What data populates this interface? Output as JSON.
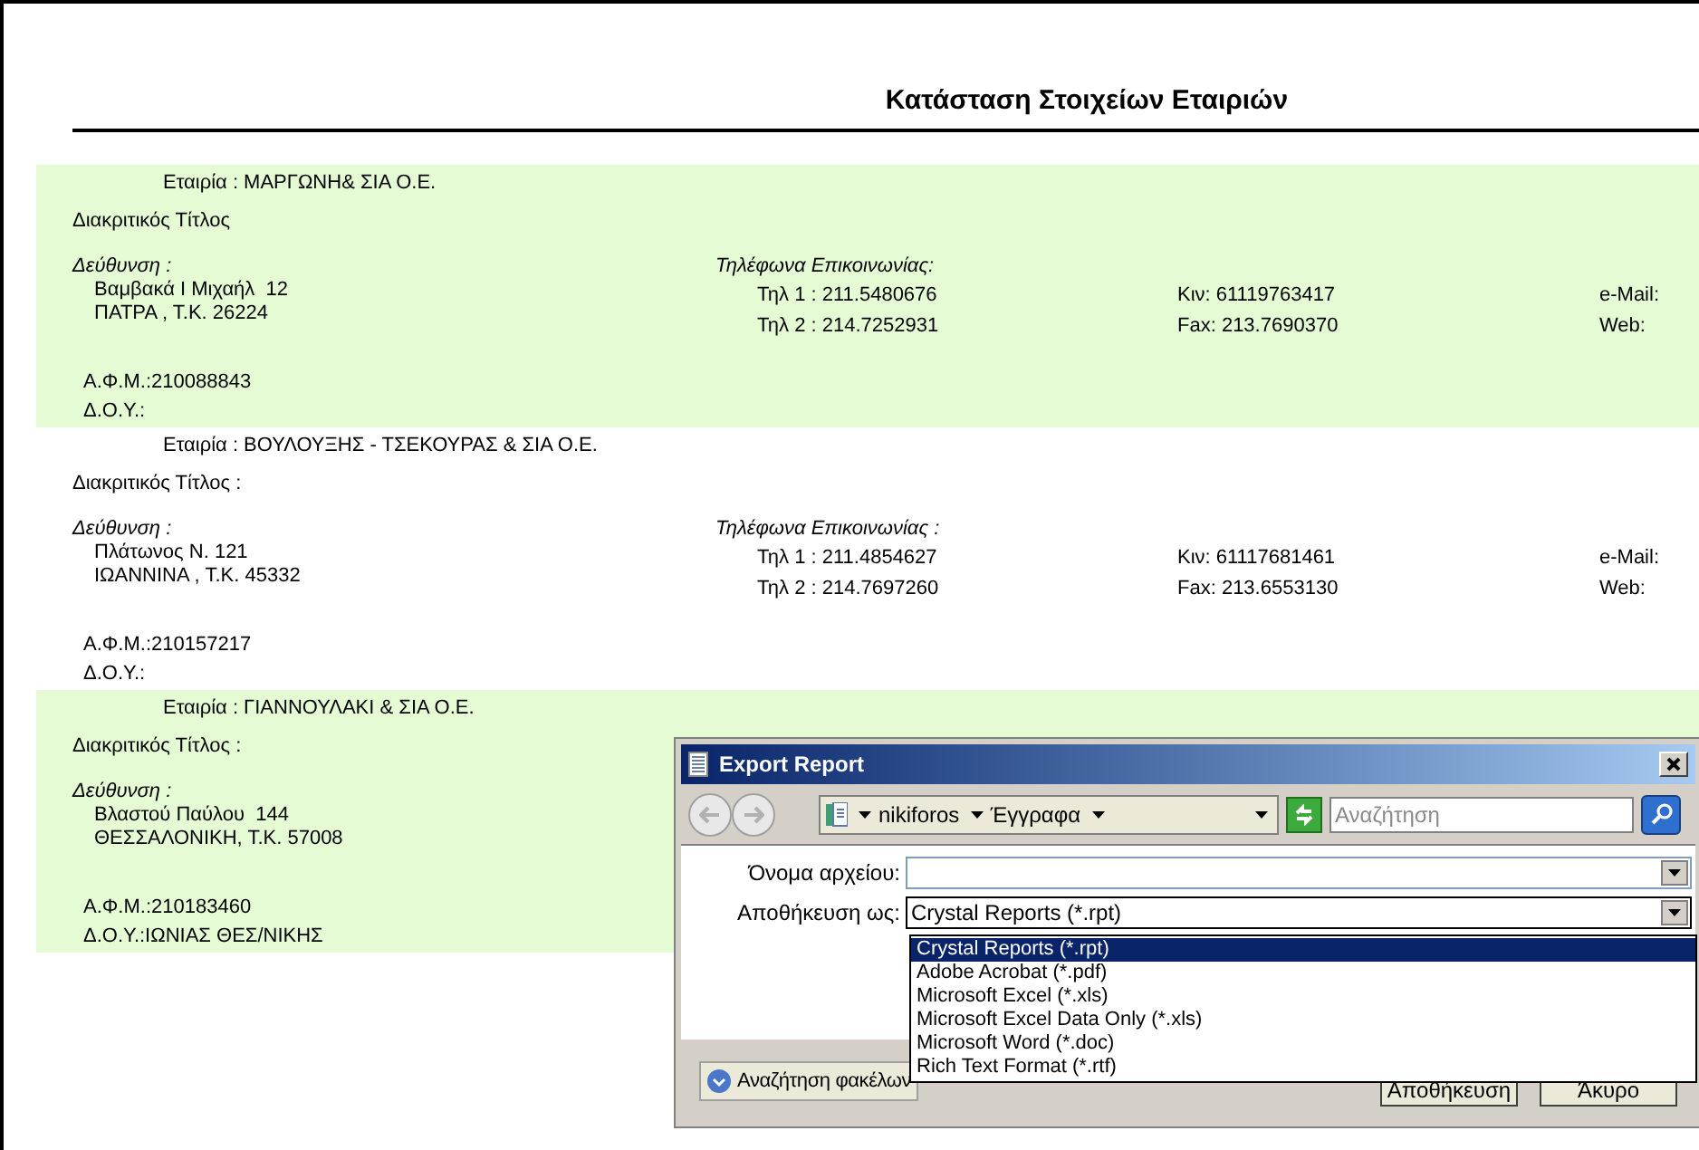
{
  "report": {
    "title": "Κατάσταση Στοιχείων Εταιριών",
    "companies": [
      {
        "highlighted": true,
        "company": "Εταιρία : ΜΑΡΓΩΝΗ& ΣΙΑ Ο.Ε.",
        "title": "Διακριτικός Τίτλος",
        "address_label": "Δεύθυνση :",
        "address": [
          "Βαμβακά Ι Μιχαήλ  12",
          "ΠΑΤΡΑ , Τ.Κ. 26224"
        ],
        "phones_label": "Τηλέφωνα Επικοινωνίας:",
        "phone_1": "Τηλ 1 : 211.5480676",
        "phone_2": "Τηλ 2 : 214.7252931",
        "mobile": "Κιν: 61119763417",
        "fax": "Fax: 213.7690370",
        "email": "e-Mail:",
        "web": "Web:",
        "afm": "Α.Φ.Μ.:210088843",
        "doy": "Δ.Ο.Υ.:"
      },
      {
        "highlighted": false,
        "company": "Εταιρία : ΒΟΥΛΟΥΞΗΣ - ΤΣΕΚΟΥΡΑΣ & ΣΙΑ Ο.Ε.",
        "title": "Διακριτικός Τίτλος :",
        "address_label": "Δεύθυνση :",
        "address": [
          "Πλάτωνος Ν. 121",
          "ΙΩΑΝΝΙΝΑ , Τ.Κ. 45332"
        ],
        "phones_label": "Τηλέφωνα Επικοινωνίας :",
        "phone_1": "Τηλ 1 : 211.4854627",
        "phone_2": "Τηλ 2 : 214.7697260",
        "mobile": "Κιν: 61117681461",
        "fax": "Fax: 213.6553130",
        "email": "e-Mail:",
        "web": "Web:",
        "afm": "Α.Φ.Μ.:210157217",
        "doy": "Δ.Ο.Υ.:"
      },
      {
        "highlighted": true,
        "company": "Εταιρία : ΓΙΑΝΝΟΥΛΑΚΙ & ΣΙΑ Ο.Ε.",
        "title": "Διακριτικός Τίτλος :",
        "address_label": "Δεύθυνση :",
        "address": [
          "Βλαστού Παύλου  144",
          "ΘΕΣΣΑΛΟΝΙΚΗ, Τ.Κ. 57008"
        ],
        "afm": "Α.Φ.Μ.:210183460",
        "doy": "Δ.Ο.Υ.:ΙΩΝΙΑΣ ΘΕΣ/ΝΙΚΗΣ"
      }
    ]
  },
  "dialog": {
    "title": "Export Report",
    "breadcrumbs": [
      "nikiforos",
      "Έγγραφα"
    ],
    "search": {
      "placeholder": "Αναζήτηση"
    },
    "file_name": {
      "label": "Όνομα αρχείου:"
    },
    "save_as": {
      "label": "Αποθήκευση ως:",
      "value": "Crystal Reports (*.rpt)",
      "expanded": true,
      "options": [
        {
          "label": "Crystal Reports (*.rpt)",
          "selected": true
        },
        {
          "label": "Adobe Acrobat (*.pdf)",
          "selected": false
        },
        {
          "label": "Microsoft Excel (*.xls)",
          "selected": false
        },
        {
          "label": "Microsoft Excel Data Only (*.xls)",
          "selected": false
        },
        {
          "label": "Microsoft Word (*.doc)",
          "selected": false
        },
        {
          "label": "Rich Text Format (*.rtf)",
          "selected": false
        }
      ]
    },
    "browse_folders": "Αναζήτηση φακέλων",
    "buttons": [
      "Αποθήκευση",
      "Άκυρο"
    ]
  }
}
